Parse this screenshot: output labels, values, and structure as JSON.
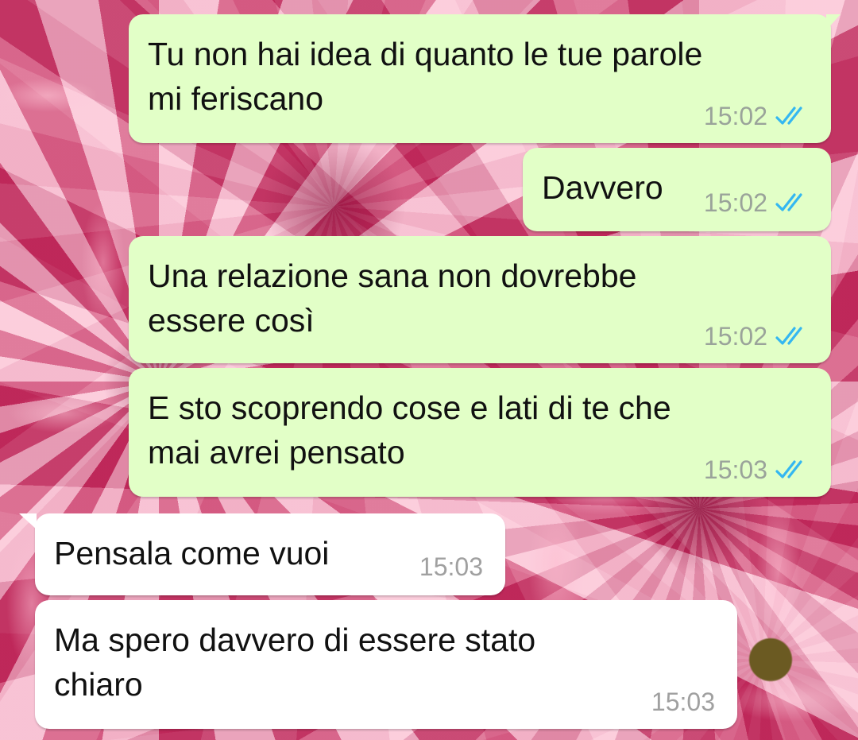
{
  "conversation": {
    "messages": [
      {
        "direction": "outgoing",
        "lines": [
          "Tu non hai idea di quanto le tue parole",
          "mi feriscano"
        ],
        "time": "15:02",
        "status_icon": "double-check-read-icon"
      },
      {
        "direction": "outgoing",
        "lines": [
          "Davvero"
        ],
        "time": "15:02",
        "status_icon": "double-check-read-icon"
      },
      {
        "direction": "outgoing",
        "lines": [
          "Una relazione sana non dovrebbe",
          "essere così"
        ],
        "time": "15:02",
        "status_icon": "double-check-read-icon"
      },
      {
        "direction": "outgoing",
        "lines": [
          "E sto scoprendo cose e lati di te che",
          "mai avrei pensato"
        ],
        "time": "15:03",
        "status_icon": "double-check-read-icon"
      },
      {
        "direction": "incoming",
        "lines": [
          "Pensala come vuoi"
        ],
        "time": "15:03"
      },
      {
        "direction": "incoming",
        "lines": [
          "Ma spero davvero di essere stato",
          "chiaro"
        ],
        "time": "15:03"
      }
    ]
  },
  "colors": {
    "outgoing_bubble": "#e2ffc7",
    "incoming_bubble": "#ffffff",
    "read_check": "#34b7f1",
    "background": "#c9456f"
  }
}
